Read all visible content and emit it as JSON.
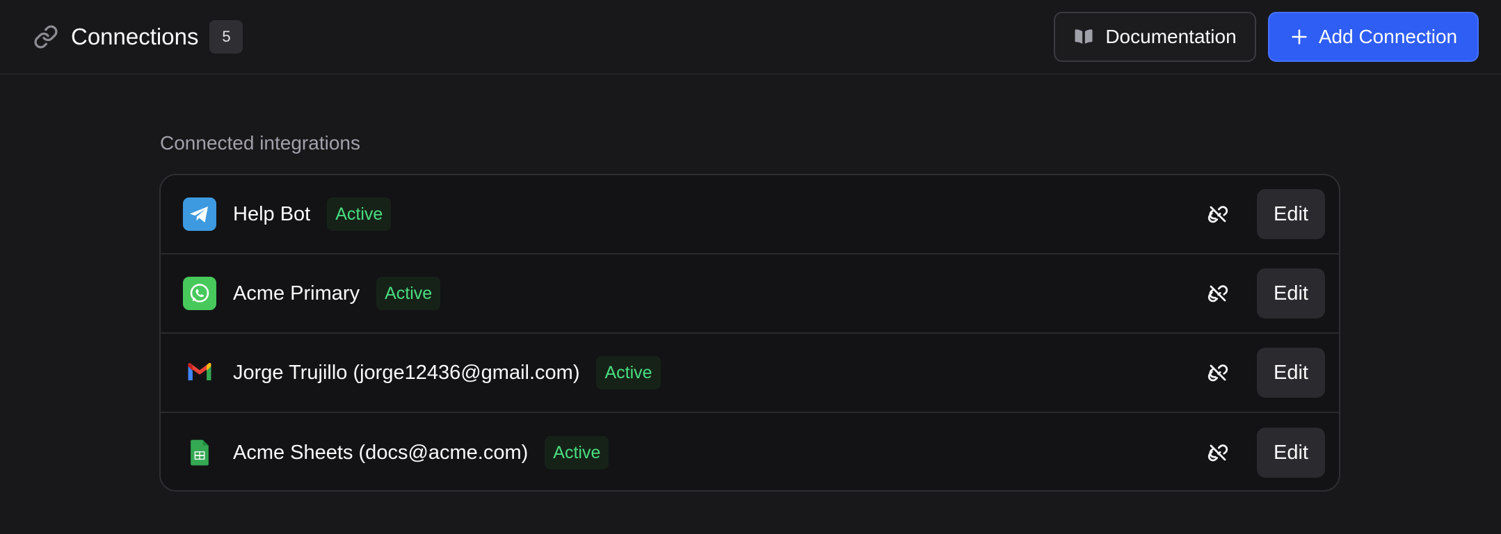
{
  "header": {
    "title": "Connections",
    "count": "5",
    "link_icon": "link-icon",
    "documentation_label": "Documentation",
    "documentation_icon": "book-open-icon",
    "add_label": "Add Connection",
    "add_icon": "plus-icon"
  },
  "section": {
    "label": "Connected integrations"
  },
  "connections": [
    {
      "name": "Help Bot",
      "status": "Active",
      "icon": "telegram-icon",
      "edit_label": "Edit"
    },
    {
      "name": "Acme Primary",
      "status": "Active",
      "icon": "whatsapp-icon",
      "edit_label": "Edit"
    },
    {
      "name": "Jorge Trujillo (jorge12436@gmail.com)",
      "status": "Active",
      "icon": "gmail-icon",
      "edit_label": "Edit"
    },
    {
      "name": "Acme Sheets (docs@acme.com)",
      "status": "Active",
      "icon": "google-sheets-icon",
      "edit_label": "Edit"
    }
  ],
  "colors": {
    "background": "#18181b",
    "accent": "#2f5ef5",
    "status_active": "#4ade80"
  }
}
